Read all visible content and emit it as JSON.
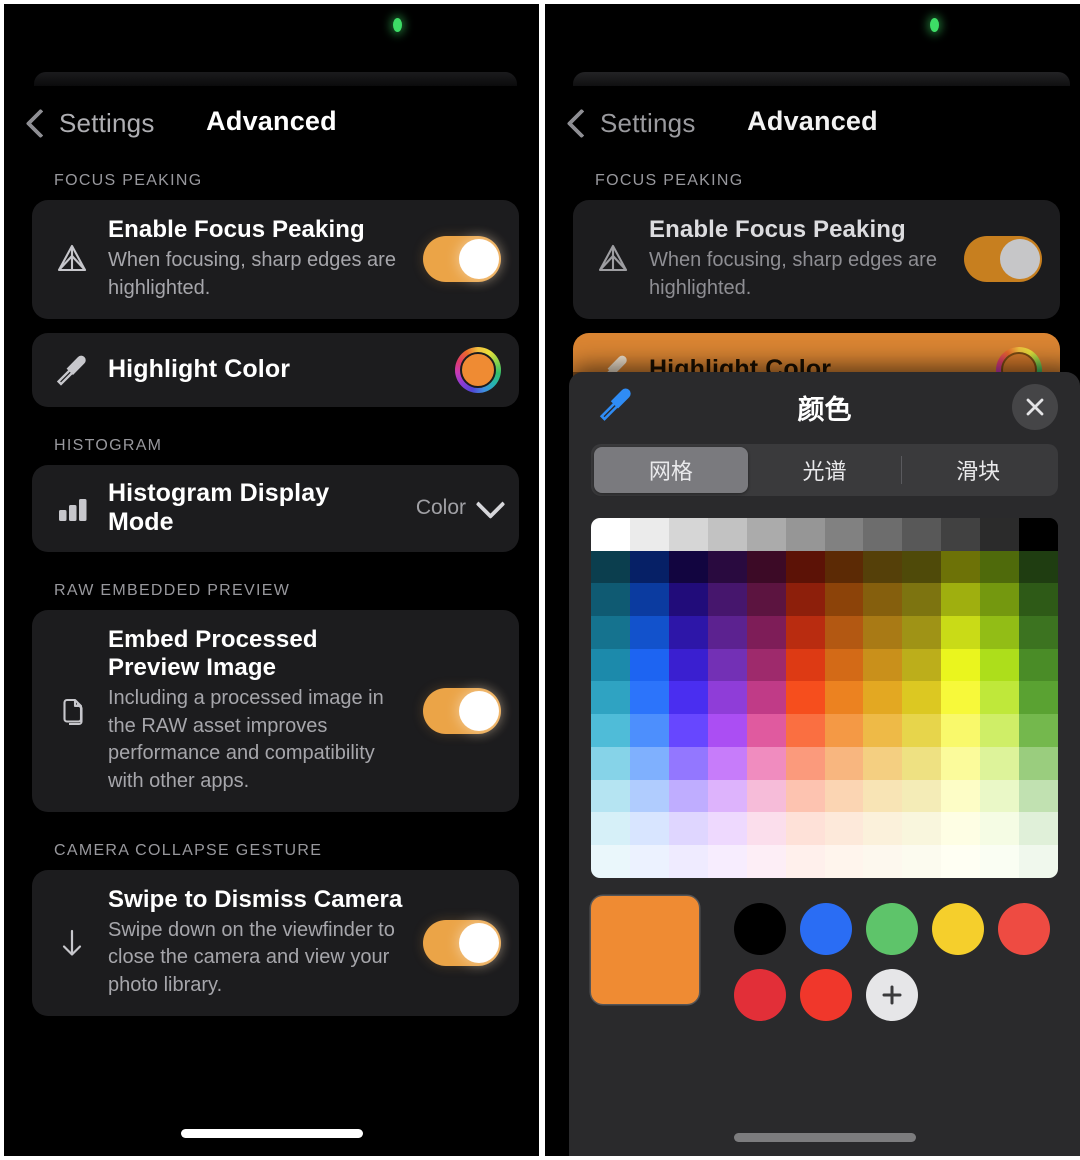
{
  "app": {
    "nav": {
      "back_label": "Settings",
      "title": "Advanced"
    }
  },
  "settings": {
    "sections": [
      {
        "header": "FOCUS PEAKING",
        "rows": [
          {
            "icon": "aperture-triangle-icon",
            "title": "Enable Focus Peaking",
            "subtitle": "When focusing, sharp edges are highlighted.",
            "control": "toggle",
            "toggle_on": true
          },
          {
            "icon": "eyedropper-icon",
            "title": "Highlight Color",
            "control": "color-wheel",
            "color": "#ef8b33"
          }
        ]
      },
      {
        "header": "HISTOGRAM",
        "rows": [
          {
            "icon": "bar-chart-icon",
            "title": "Histogram Display Mode",
            "control": "menu",
            "value": "Color"
          }
        ]
      },
      {
        "header": "RAW EMBEDDED PREVIEW",
        "rows": [
          {
            "icon": "documents-icon",
            "title": "Embed Processed Preview Image",
            "subtitle": "Including a processed image in the RAW asset improves performance and compatibility with other apps.",
            "control": "toggle",
            "toggle_on": true
          }
        ]
      },
      {
        "header": "CAMERA COLLAPSE GESTURE",
        "rows": [
          {
            "icon": "arrow-down-icon",
            "title": "Swipe to Dismiss Camera",
            "subtitle": "Swipe down on the viewfinder to close the camera and view your photo library.",
            "control": "toggle",
            "toggle_on": true
          }
        ]
      }
    ]
  },
  "color_picker": {
    "title": "颜色",
    "eyedropper_icon": "eyedropper-icon",
    "close_icon": "close-icon",
    "tabs": [
      {
        "label": "网格",
        "active": true
      },
      {
        "label": "光谱",
        "active": false
      },
      {
        "label": "滑块",
        "active": false
      }
    ],
    "grid": {
      "columns": 12,
      "rows": 11,
      "row_colors": [
        [
          "#ffffff",
          "#ebebeb",
          "#d6d6d6",
          "#c2c2c2",
          "#ababab",
          "#969696",
          "#818181",
          "#6d6d6d",
          "#585858",
          "#414141",
          "#2b2b2b",
          "#000000"
        ],
        [
          "#0b3e4e",
          "#062066",
          "#120540",
          "#290a3f",
          "#3c0a26",
          "#5c1206",
          "#5c2a05",
          "#554009",
          "#4f4a09",
          "#6d7207",
          "#4f6a0b",
          "#1f3d11"
        ],
        [
          "#0f5a72",
          "#0b3ba0",
          "#210c7a",
          "#46166d",
          "#5c1440",
          "#8d1f0b",
          "#8c4309",
          "#855f0d",
          "#7d7410",
          "#9faf0f",
          "#74980f",
          "#2e5a17"
        ],
        [
          "#15738f",
          "#1252cc",
          "#2d16a8",
          "#5c2290",
          "#7e1d58",
          "#b92c10",
          "#b35812",
          "#a97a15",
          "#9f9316",
          "#c9db17",
          "#92bd16",
          "#3c7320"
        ],
        [
          "#1c8aab",
          "#1d64f2",
          "#3a1fd0",
          "#7330b5",
          "#9e2a6c",
          "#dd3a14",
          "#d36a17",
          "#c9901b",
          "#bcae1b",
          "#eaf51e",
          "#adde1b",
          "#4a8c27"
        ],
        [
          "#2fa3c2",
          "#2c74fb",
          "#4a2ef0",
          "#8f3dd8",
          "#c03b87",
          "#f64e1d",
          "#ec8220",
          "#e3a822",
          "#dcc822",
          "#f7f93a",
          "#bfe83a",
          "#5aa232"
        ],
        [
          "#4fbcd8",
          "#4d8ffd",
          "#6747ff",
          "#ab4ef3",
          "#e05a9f",
          "#fa6f41",
          "#f49945",
          "#eeba47",
          "#e7d54b",
          "#f9f96b",
          "#cfee67",
          "#74b84d"
        ],
        [
          "#86d3e8",
          "#7fb0fe",
          "#9377ff",
          "#c77cfa",
          "#f08cbf",
          "#fb9a7c",
          "#f8b67f",
          "#f4cf81",
          "#eee182",
          "#fbfb9b",
          "#ddf39a",
          "#9acd7e"
        ],
        [
          "#b5e4f2",
          "#b0ccfe",
          "#bfadff",
          "#ddb3fc",
          "#f6bcd9",
          "#fdc3b0",
          "#fbd5b3",
          "#f8e4b5",
          "#f4ecb7",
          "#fdfdc6",
          "#eaf8c7",
          "#c1e1b1"
        ],
        [
          "#d6f0f8",
          "#d8e5ff",
          "#dfd6ff",
          "#eed9fe",
          "#fbdeec",
          "#fee1d8",
          "#fde9da",
          "#fbf1db",
          "#f9f6dd",
          "#fefee4",
          "#f5fce4",
          "#e0f0d9"
        ],
        [
          "#eaf7fb",
          "#ecf2ff",
          "#efebff",
          "#f7edfe",
          "#fdeef6",
          "#fff0ec",
          "#fff5ed",
          "#fdf8ee",
          "#fcfbef",
          "#fffff3",
          "#fafef3",
          "#f0f8ed"
        ]
      ]
    },
    "current_color": "#ef8b33",
    "recent_swatches": [
      {
        "name": "black",
        "color": "#000000"
      },
      {
        "name": "blue",
        "color": "#2a6df4"
      },
      {
        "name": "green",
        "color": "#5ec46a"
      },
      {
        "name": "yellow",
        "color": "#f5cf2c"
      },
      {
        "name": "red",
        "color": "#ee4b42"
      },
      {
        "name": "red-2",
        "color": "#e22f38"
      },
      {
        "name": "red-3",
        "color": "#f0372b"
      }
    ],
    "add_label": "+"
  }
}
